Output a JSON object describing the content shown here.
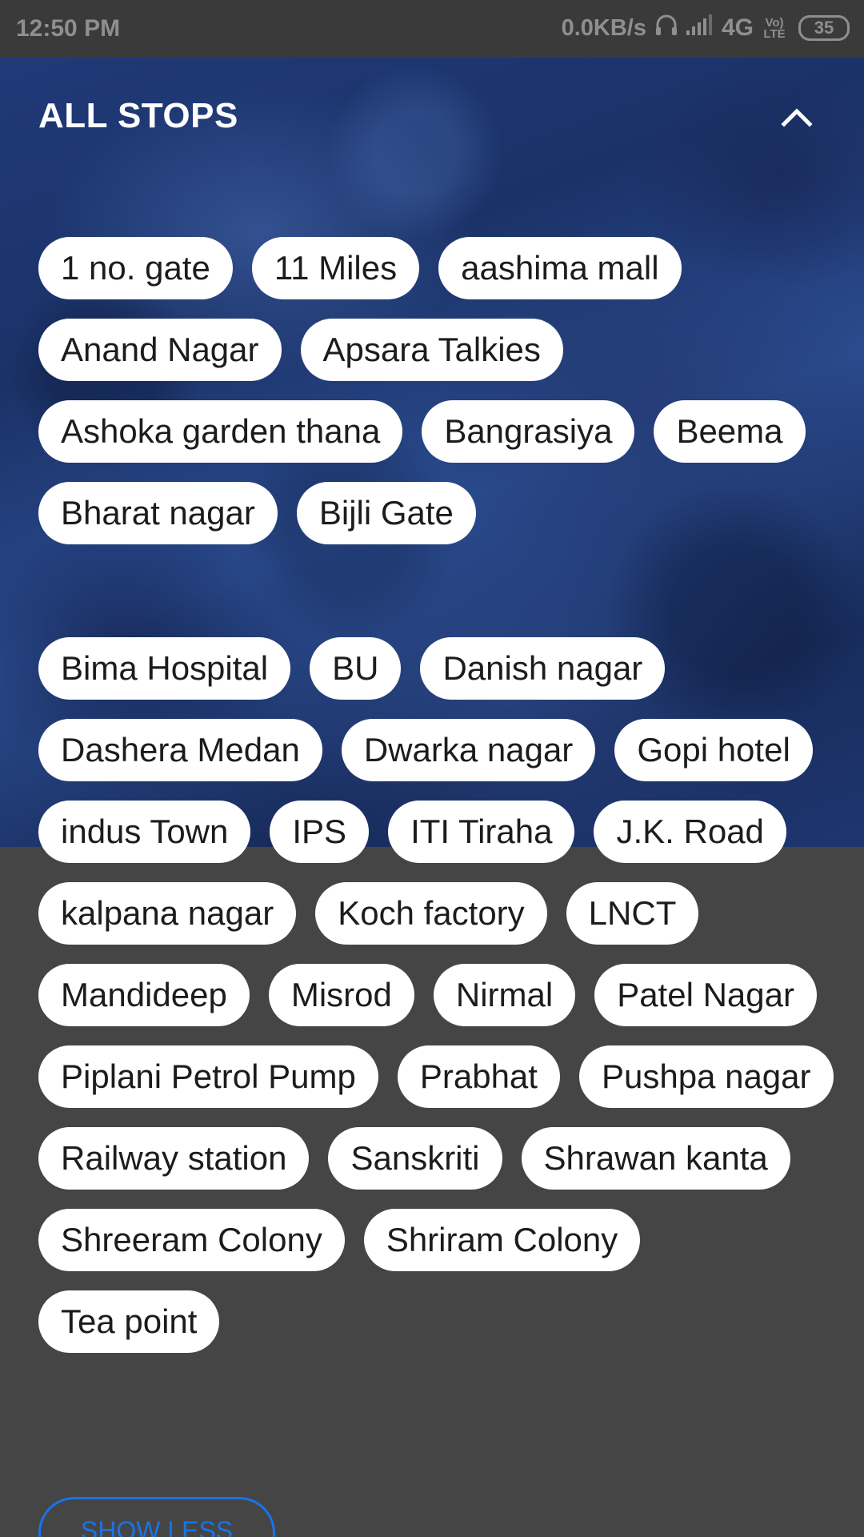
{
  "status_bar": {
    "time": "12:50 PM",
    "speed": "0.0KB/s",
    "network": "4G",
    "volte": "Vo) LTE",
    "battery": "35"
  },
  "stops_section": {
    "title": "ALL STOPS",
    "collapse_icon": "chevron-up-icon",
    "show_less_label": "SHOW LESS"
  },
  "stops_group_1": [
    "1 no. gate",
    "11 Miles",
    "aashima mall",
    "Anand Nagar",
    "Apsara Talkies",
    "Ashoka garden thana",
    "Bangrasiya",
    "Beema",
    "Bharat nagar",
    "Bijli Gate"
  ],
  "stops_group_2": [
    "Bima Hospital",
    "BU",
    "Danish nagar",
    "Dashera Medan",
    "Dwarka nagar",
    "Gopi hotel",
    "indus Town",
    "IPS",
    "ITI Tiraha",
    "J.K. Road",
    "kalpana nagar",
    "Koch factory",
    "LNCT",
    "Mandideep",
    "Misrod",
    "Nirmal",
    "Patel Nagar",
    "Piplani Petrol Pump",
    "Prabhat",
    "Pushpa nagar",
    "Railway station",
    "Sanskriti",
    "Shrawan kanta",
    "Shreeram Colony",
    "Shriram Colony",
    "Tea point"
  ],
  "colors": {
    "accent": "#1a73e8",
    "chip_bg": "#ffffff",
    "page_bg": "#454545"
  }
}
